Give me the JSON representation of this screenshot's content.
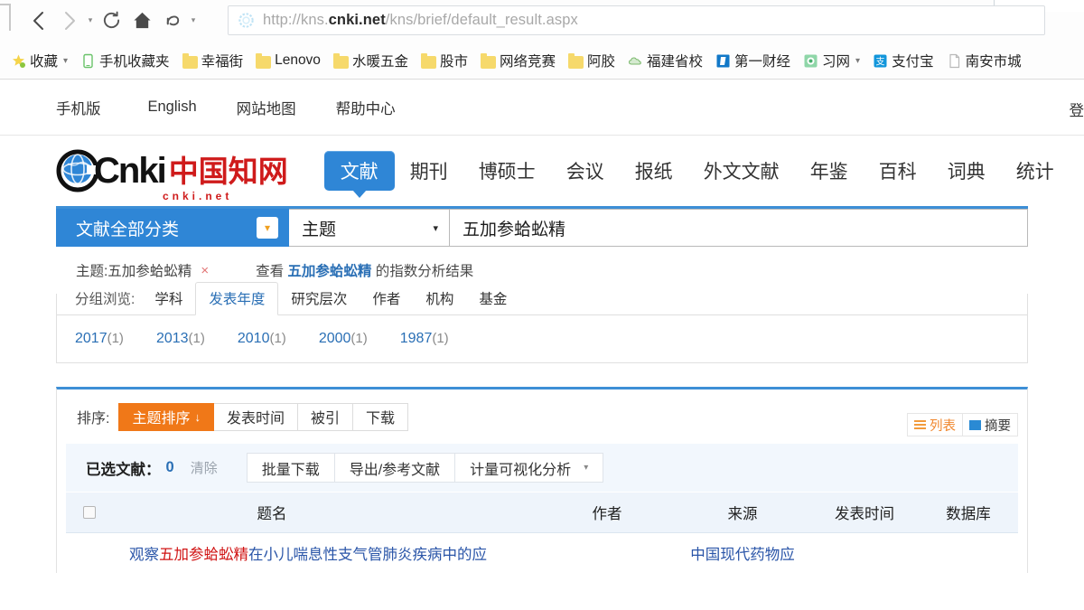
{
  "browser": {
    "url_prefix": "http://kns.",
    "url_domain": "cnki.net",
    "url_path": "/kns/brief/default_result.aspx",
    "back_icon": "‹",
    "forward_icon": "›",
    "reload_label": "reload-icon",
    "home_label": "home-icon",
    "undo_label": "undo-icon",
    "caret": "▾"
  },
  "bookmarks": [
    {
      "label": "收藏",
      "icon": "star-icon",
      "caret": true
    },
    {
      "label": "手机收藏夹",
      "icon": "phone-icon",
      "caret": false
    },
    {
      "label": "幸福街",
      "icon": "folder-icon",
      "caret": false
    },
    {
      "label": "Lenovo",
      "icon": "folder-icon",
      "caret": false
    },
    {
      "label": "水暖五金",
      "icon": "folder-icon",
      "caret": false
    },
    {
      "label": "股市",
      "icon": "folder-icon",
      "caret": false
    },
    {
      "label": "网络竞赛",
      "icon": "folder-icon",
      "caret": false
    },
    {
      "label": "阿胶",
      "icon": "folder-icon",
      "caret": false
    },
    {
      "label": "福建省校",
      "icon": "cloud-icon",
      "caret": false
    },
    {
      "label": "第一财经",
      "icon": "blue-square-icon",
      "caret": false
    },
    {
      "label": "习网",
      "icon": "green-square-icon",
      "caret": true
    },
    {
      "label": "支付宝",
      "icon": "alipay-icon",
      "caret": false
    },
    {
      "label": "南安市城",
      "icon": "page-icon",
      "caret": false
    }
  ],
  "util_nav": {
    "links": [
      "手机版",
      "English",
      "网站地图",
      "帮助中心"
    ],
    "login": "登"
  },
  "site": {
    "logo_text": "Cnki",
    "logo_cn": "中国知网",
    "logo_sub": "cnki.net"
  },
  "main_tabs": [
    {
      "label": "文献",
      "active": true
    },
    {
      "label": "期刊",
      "active": false
    },
    {
      "label": "博硕士",
      "active": false
    },
    {
      "label": "会议",
      "active": false
    },
    {
      "label": "报纸",
      "active": false
    },
    {
      "label": "外文文献",
      "active": false
    },
    {
      "label": "年鉴",
      "active": false
    },
    {
      "label": "百科",
      "active": false
    },
    {
      "label": "词典",
      "active": false
    },
    {
      "label": "统计",
      "active": false
    }
  ],
  "search": {
    "category_label": "文献全部分类",
    "category_caret": "▾",
    "field_label": "主题",
    "field_caret": "▾",
    "query_value": "五加参蛤蚣精",
    "refine_tag": "主题:五加参蛤蚣精",
    "refine_close": "×",
    "index_prefix": "查看 ",
    "index_term": "五加参蛤蚣精",
    "index_suffix": " 的指数分析结果"
  },
  "group": {
    "label": "分组浏览:",
    "tabs": [
      {
        "label": "学科",
        "active": false
      },
      {
        "label": "发表年度",
        "active": true
      },
      {
        "label": "研究层次",
        "active": false
      },
      {
        "label": "作者",
        "active": false
      },
      {
        "label": "机构",
        "active": false
      },
      {
        "label": "基金",
        "active": false
      }
    ],
    "years": [
      {
        "year": "2017",
        "count": "(1)"
      },
      {
        "year": "2013",
        "count": "(1)"
      },
      {
        "year": "2010",
        "count": "(1)"
      },
      {
        "year": "2000",
        "count": "(1)"
      },
      {
        "year": "1987",
        "count": "(1)"
      }
    ]
  },
  "sort": {
    "label": "排序:",
    "buttons": [
      {
        "label": "主题排序",
        "active": true,
        "arrow": "↓"
      },
      {
        "label": "发表时间",
        "active": false,
        "arrow": ""
      },
      {
        "label": "被引",
        "active": false,
        "arrow": ""
      },
      {
        "label": "下载",
        "active": false,
        "arrow": ""
      }
    ],
    "views": [
      {
        "label": "列表",
        "icon": "list-view-icon"
      },
      {
        "label": "摘要",
        "icon": "abstract-view-icon"
      }
    ]
  },
  "actions": {
    "selected_label": "已选文献：",
    "selected_count": "0",
    "clear_label": "清除",
    "buttons": [
      {
        "label": "批量下载",
        "caret": false
      },
      {
        "label": "导出/参考文献",
        "caret": false
      },
      {
        "label": "计量可视化分析",
        "caret": true
      }
    ],
    "caret": "▾"
  },
  "table": {
    "columns": [
      "题名",
      "作者",
      "来源",
      "发表时间",
      "数据库"
    ],
    "rows": [
      {
        "title_pre": "观察",
        "title_hl": "五加参蛤蚣精",
        "title_post": "在小儿喘息性支气管肺炎疾病中的应",
        "author": "",
        "source": "中国现代药物应",
        "date": "",
        "db": ""
      }
    ]
  }
}
